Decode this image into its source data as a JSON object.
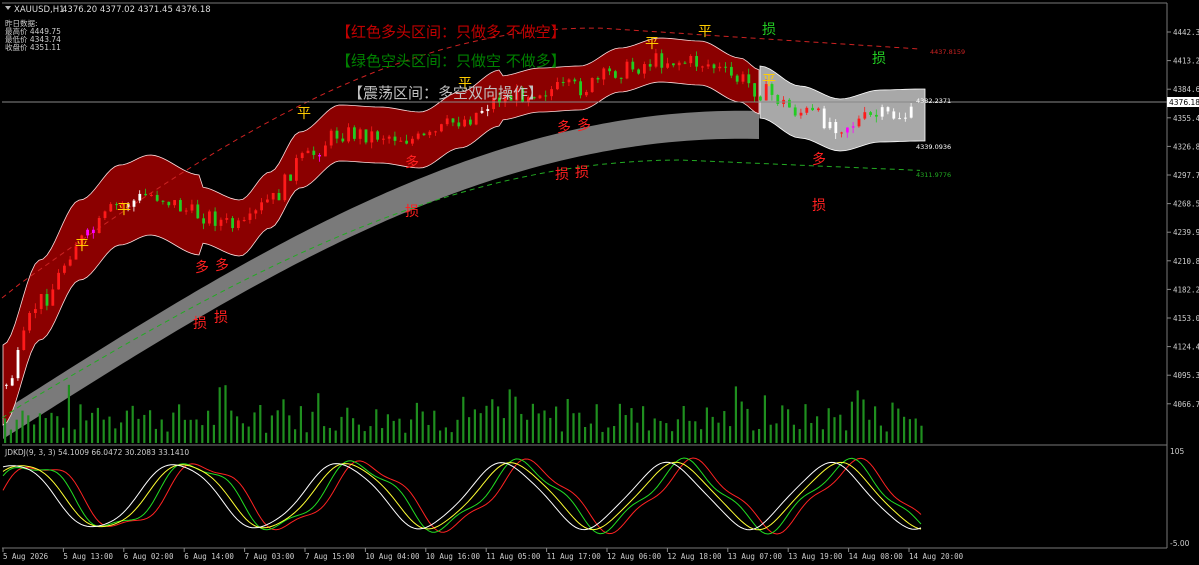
{
  "window": {
    "title": "XAUUSD,H1",
    "ohlc_readout": "4376.20 4377.02 4371.45 4376.18"
  },
  "info_panel": [
    "昨日数据:",
    "最高价 4449.75",
    "最低价 4343.74",
    "收盘价 4351.11"
  ],
  "banners": [
    {
      "text": "【红色多头区间：只做多 不做空】",
      "color": "#c00000"
    },
    {
      "text": "【绿色空头区间：只做空 不做多】",
      "color": "#008000"
    },
    {
      "text": "【震荡区间：多空双向操作】",
      "color": "#c0c0c0"
    }
  ],
  "price_axis": {
    "ticks": [
      "4442.35",
      "4413.20",
      "4384.60",
      "4355.45",
      "4326.85",
      "4297.70",
      "4268.55",
      "4239.95",
      "4210.80",
      "4182.20",
      "4153.05",
      "4124.45",
      "4095.30",
      "4066.70"
    ],
    "current_price": "4376.18"
  },
  "level_labels": [
    {
      "text": "4437.8159",
      "color": "#cc2222"
    },
    {
      "text": "4382.2371",
      "color": "#ffffff"
    },
    {
      "text": "4339.0936",
      "color": "#ffffff"
    },
    {
      "text": "4311.9776",
      "color": "#22aa22"
    }
  ],
  "signal_labels": {
    "ping": "平",
    "duo": "多",
    "sun": "损"
  },
  "indicator": {
    "label": "JDKDJ(9, 3, 3) 54.1009 66.0472 30.2083 33.1410",
    "axis_top": "105",
    "axis_bottom": "-5.00"
  },
  "time_axis": [
    "5 Aug 2026",
    "5 Aug 13:00",
    "6 Aug 02:00",
    "6 Aug 14:00",
    "7 Aug 03:00",
    "7 Aug 15:00",
    "10 Aug 04:00",
    "10 Aug 16:00",
    "11 Aug 05:00",
    "11 Aug 17:00",
    "12 Aug 06:00",
    "12 Aug 18:00",
    "13 Aug 07:00",
    "13 Aug 19:00",
    "14 Aug 08:00",
    "14 Aug 20:00"
  ],
  "colors": {
    "background": "#000000",
    "bull_zone": "#8b0000",
    "range_zone": "#a8a8a8",
    "bull_candle": "#ff1a1a",
    "bear_candle": "#22cc22",
    "white_bar": "#ffffff",
    "magenta_bar": "#ff00ff",
    "volume": "#1f8f1f",
    "grey_ribbon": "#7a7a7a",
    "ping_color": "#ffcc00",
    "duo_color": "#ff2020",
    "sun_red": "#ff2020",
    "sun_green": "#22cc22"
  }
}
